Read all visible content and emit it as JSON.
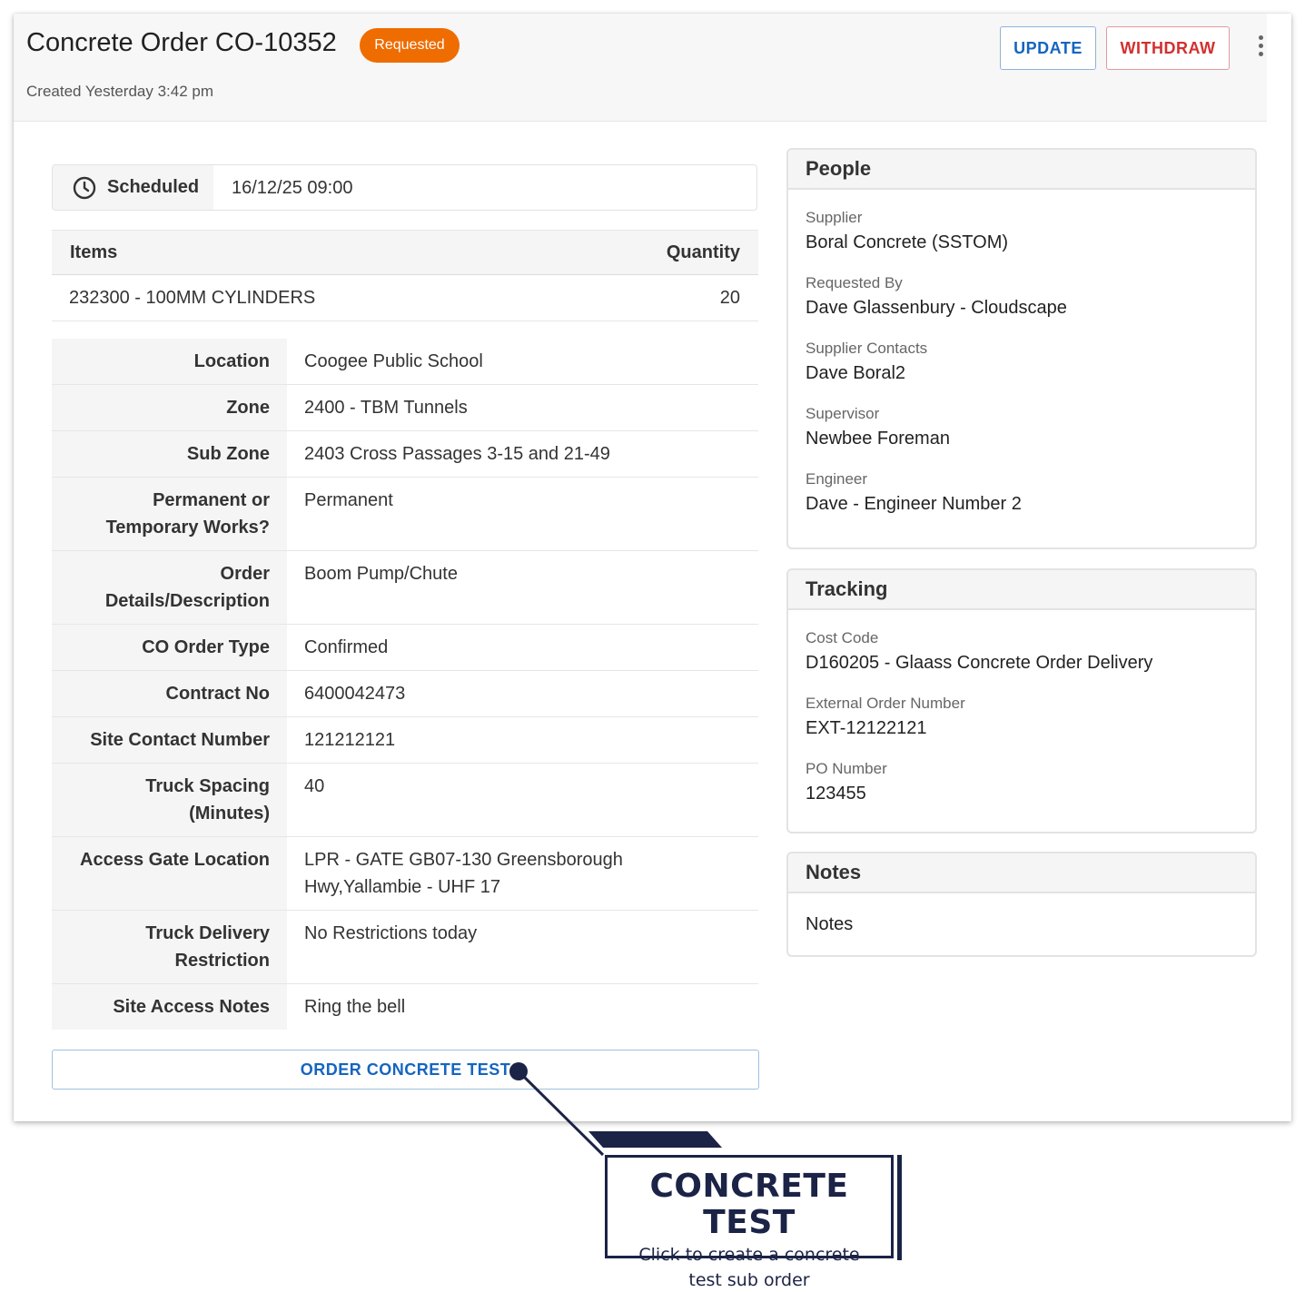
{
  "header": {
    "title": "Concrete Order CO-10352",
    "status": "Requested",
    "created": "Created Yesterday 3:42 pm",
    "update_label": "UPDATE",
    "withdraw_label": "WITHDRAW"
  },
  "schedule": {
    "label": "Scheduled",
    "value": "16/12/25 09:00"
  },
  "items": {
    "header_item": "Items",
    "header_qty": "Quantity",
    "rows": [
      {
        "item": "232300 - 100MM CYLINDERS",
        "qty": "20"
      }
    ]
  },
  "details": [
    {
      "label": "Location",
      "value": "Coogee Public School"
    },
    {
      "label": "Zone",
      "value": "2400 - TBM Tunnels"
    },
    {
      "label": "Sub Zone",
      "value": "2403 Cross Passages 3-15 and 21-49"
    },
    {
      "label": "Permanent or Temporary Works?",
      "value": "Permanent"
    },
    {
      "label": "Order Details/Description",
      "value": "Boom Pump/Chute"
    },
    {
      "label": "CO Order Type",
      "value": "Confirmed"
    },
    {
      "label": "Contract No",
      "value": "6400042473"
    },
    {
      "label": "Site Contact Number",
      "value": "121212121"
    },
    {
      "label": "Truck Spacing (Minutes)",
      "value": "40"
    },
    {
      "label": "Access Gate Location",
      "value": "LPR - GATE GB07-130 Greensborough Hwy,Yallambie - UHF 17"
    },
    {
      "label": "Truck Delivery Restriction",
      "value": "No Restrictions today"
    },
    {
      "label": "Site Access Notes",
      "value": "Ring the bell"
    }
  ],
  "order_test_label": "ORDER CONCRETE TEST",
  "people": {
    "title": "People",
    "fields": [
      {
        "label": "Supplier",
        "value": "Boral Concrete (SSTOM)"
      },
      {
        "label": "Requested By",
        "value": "Dave Glassenbury - Cloudscape"
      },
      {
        "label": "Supplier Contacts",
        "value": "Dave Boral2"
      },
      {
        "label": "Supervisor",
        "value": "Newbee Foreman"
      },
      {
        "label": "Engineer",
        "value": "Dave - Engineer Number 2"
      }
    ]
  },
  "tracking": {
    "title": "Tracking",
    "fields": [
      {
        "label": "Cost Code",
        "value": "D160205 - Glaass Concrete Order Delivery"
      },
      {
        "label": "External Order Number",
        "value": "EXT-12122121"
      },
      {
        "label": "PO Number",
        "value": "123455"
      }
    ]
  },
  "notes": {
    "title": "Notes",
    "value": "Notes"
  },
  "callout": {
    "title": "CONCRETE TEST",
    "line1": "Click to create a concrete",
    "line2": "test sub order"
  },
  "colors": {
    "status_badge": "#ef6c00",
    "primary": "#1565c0",
    "danger": "#d32f2f",
    "callout": "#1b2346"
  },
  "icons": {
    "schedule": "clock-icon",
    "more": "more-vert-icon"
  }
}
